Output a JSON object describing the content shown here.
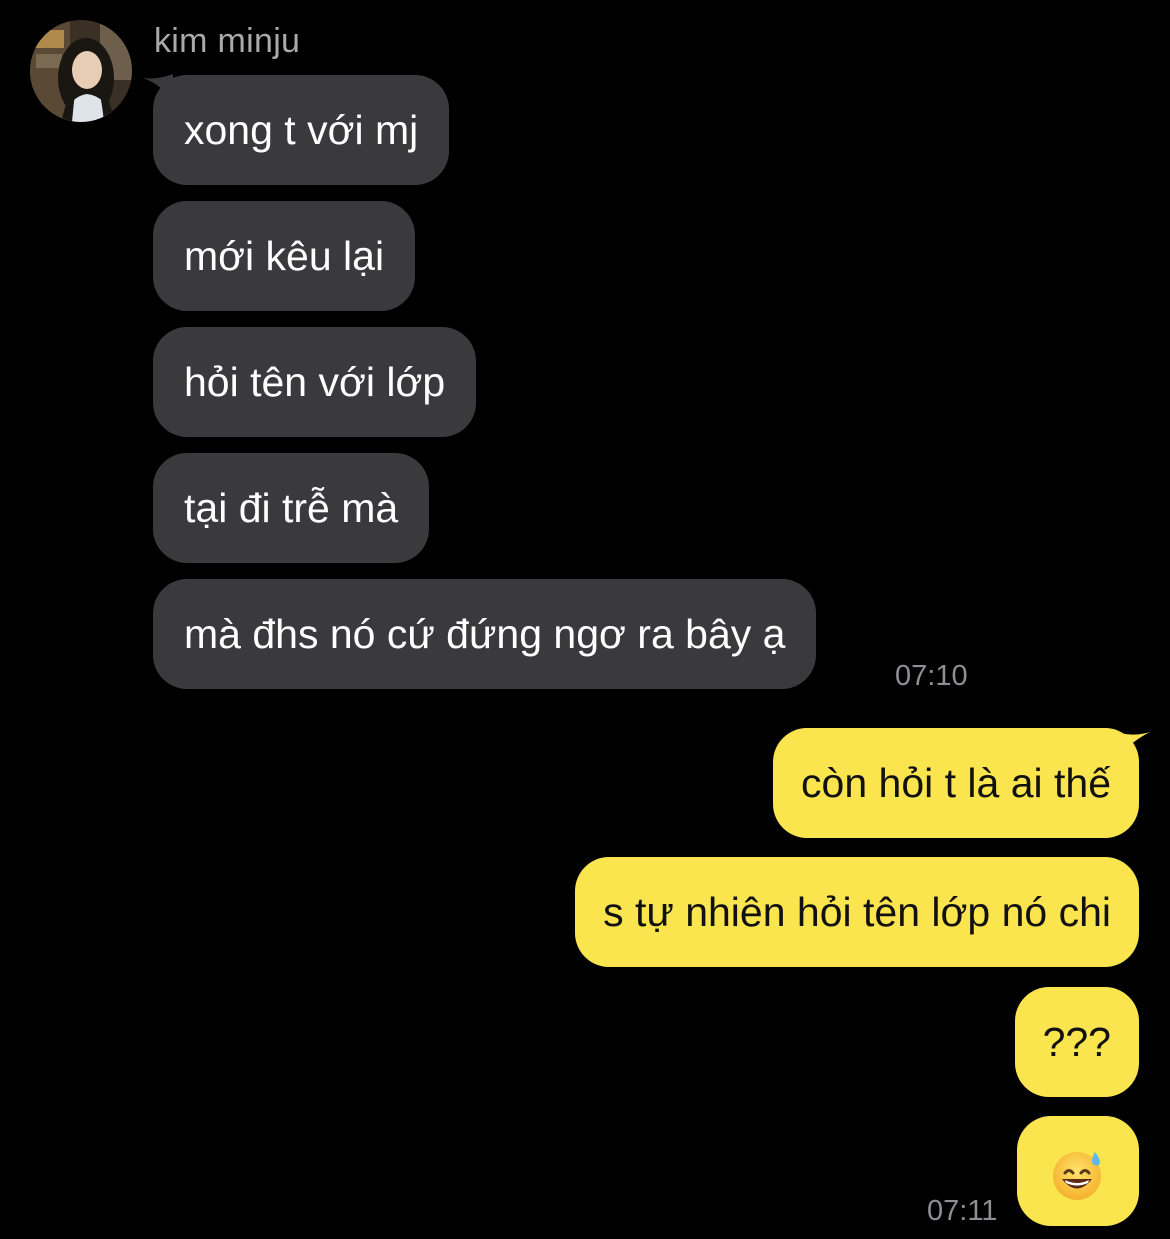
{
  "chat": {
    "sender_name": "kim minju",
    "incoming": [
      {
        "text": "xong t với mj"
      },
      {
        "text": "mới kêu lại"
      },
      {
        "text": "hỏi tên với lớp"
      },
      {
        "text": "tại đi trễ mà"
      },
      {
        "text": "mà đhs nó cứ đứng ngơ ra bây ạ"
      }
    ],
    "incoming_time": "07:10",
    "outgoing": [
      {
        "text": "còn hỏi t là ai thế"
      },
      {
        "text": "s tự nhiên hỏi tên lớp nó chi"
      },
      {
        "text": "???"
      },
      {
        "text": "😅"
      }
    ],
    "outgoing_time": "07:11"
  },
  "colors": {
    "background": "#000000",
    "incoming_bubble": "#3a3a3c",
    "outgoing_bubble": "#fae54f",
    "timestamp": "#8e8e93"
  },
  "icons": {
    "avatar": "profile-photo",
    "emoji": "grinning-face-with-sweat-emoji"
  }
}
